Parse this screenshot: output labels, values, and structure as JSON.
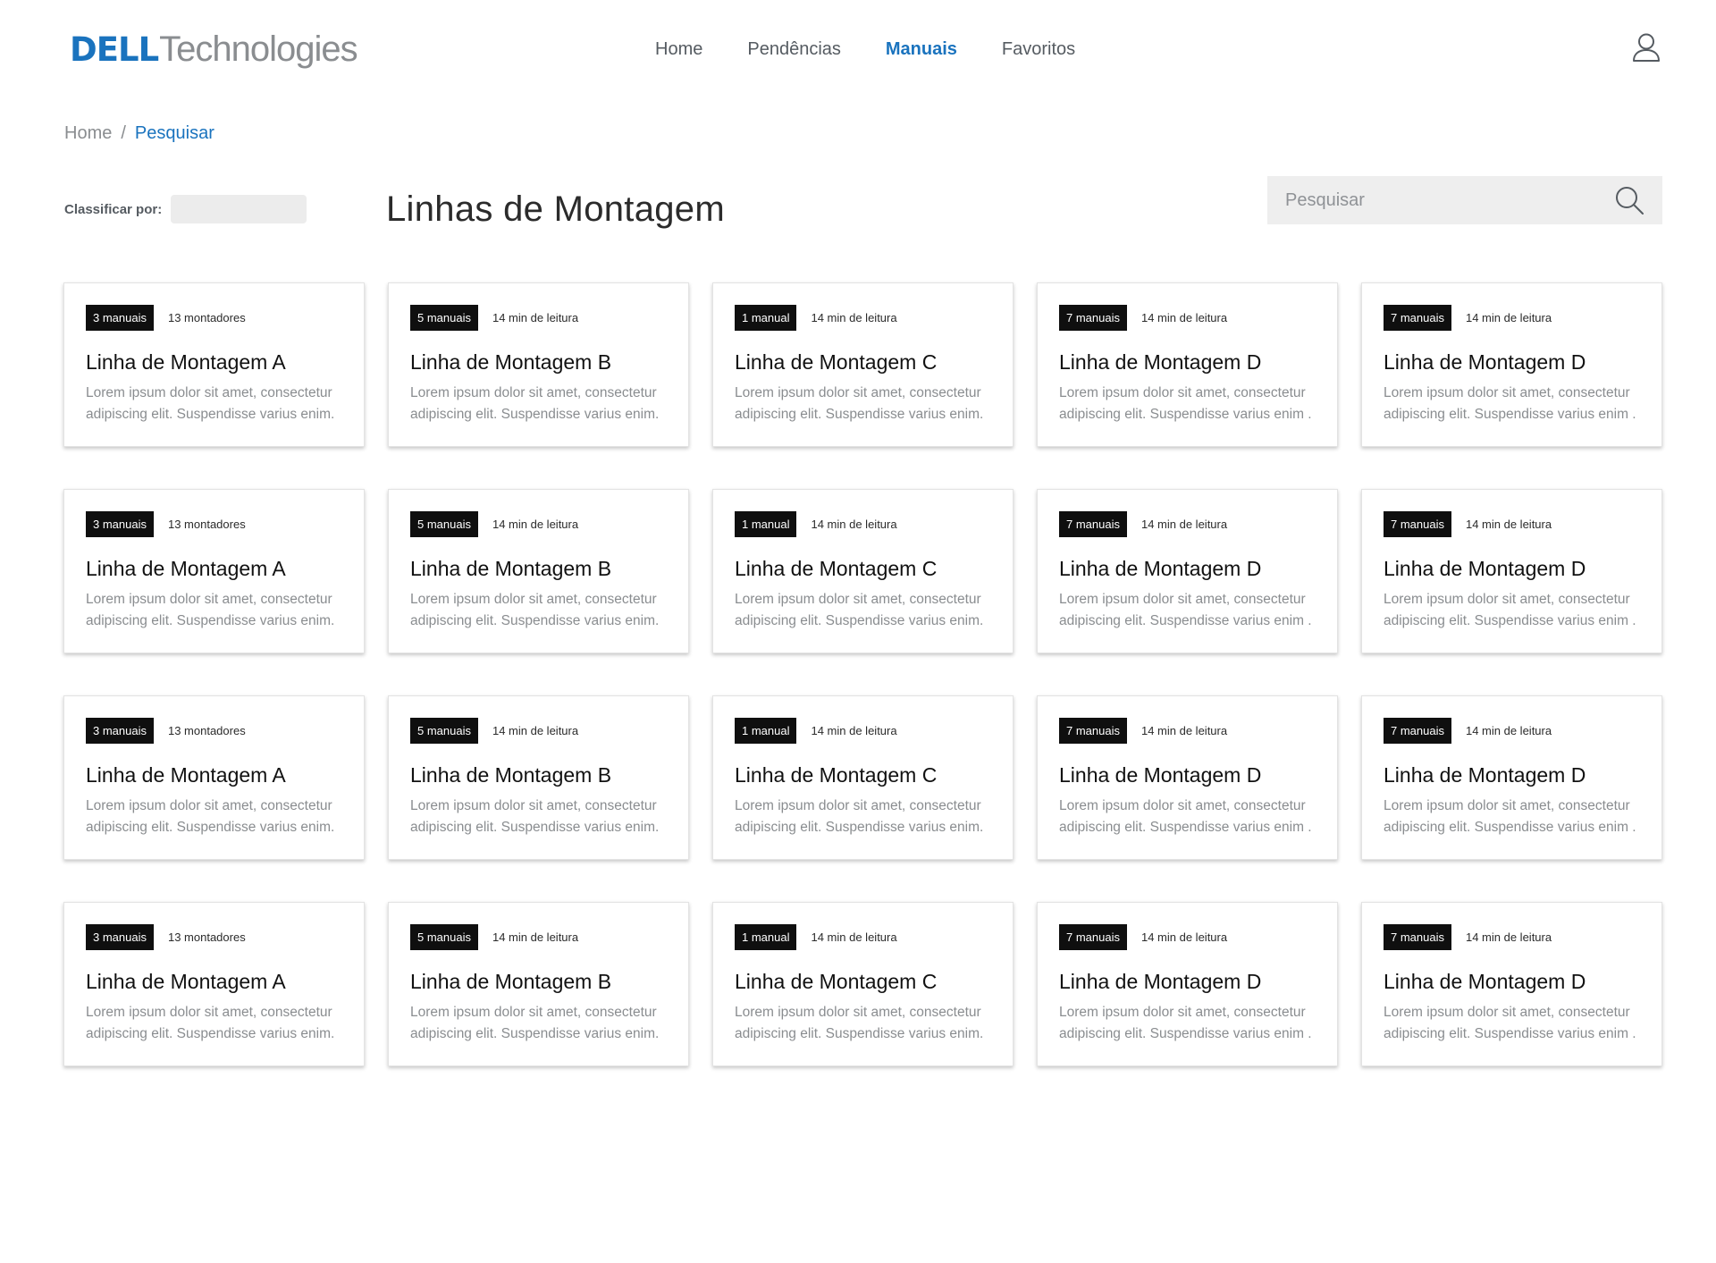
{
  "brand": {
    "logo_main": "DELL",
    "logo_sub": "Technologies"
  },
  "nav": {
    "items": [
      {
        "label": "Home",
        "active": false
      },
      {
        "label": "Pendências",
        "active": false
      },
      {
        "label": "Manuais",
        "active": true
      },
      {
        "label": "Favoritos",
        "active": false
      }
    ]
  },
  "user": {
    "icon": "user-icon"
  },
  "breadcrumb": {
    "home": "Home",
    "separator": "/",
    "current": "Pesquisar"
  },
  "sort": {
    "label": "Classificar por:",
    "value": ""
  },
  "page": {
    "title": "Linhas de Montagem"
  },
  "search": {
    "placeholder": "Pesquisar",
    "icon": "search-icon"
  },
  "colors": {
    "accent": "#1a73be",
    "badge_bg": "#0f0f0f",
    "muted_text": "#8a8d90",
    "search_bg": "#eeeeee"
  },
  "cards": [
    {
      "badge": "3 manuais",
      "meta": "13 montadores",
      "title": "Linha de Montagem A",
      "desc": "Lorem ipsum dolor sit amet, consectetur\nadipiscing elit. Suspendisse varius enim."
    },
    {
      "badge": "5 manuais",
      "meta": "14 min de leitura",
      "title": "Linha de Montagem B",
      "desc": "Lorem ipsum dolor sit amet, consectetur\nadipiscing elit. Suspendisse varius enim."
    },
    {
      "badge": "1 manual",
      "meta": "14 min de leitura",
      "title": "Linha de Montagem C",
      "desc": "Lorem ipsum dolor sit amet, consectetur\nadipiscing elit. Suspendisse varius enim."
    },
    {
      "badge": "7 manuais",
      "meta": "14 min de leitura",
      "title": "Linha de Montagem D",
      "desc": "Lorem ipsum dolor sit amet, consectetur\nadipiscing elit. Suspendisse varius enim ."
    },
    {
      "badge": "7 manuais",
      "meta": "14 min de leitura",
      "title": "Linha de Montagem D",
      "desc": "Lorem ipsum dolor sit amet, consectetur\nadipiscing elit. Suspendisse varius enim ."
    },
    {
      "badge": "3 manuais",
      "meta": "13 montadores",
      "title": "Linha de Montagem A",
      "desc": "Lorem ipsum dolor sit amet, consectetur\nadipiscing elit. Suspendisse varius enim."
    },
    {
      "badge": "5 manuais",
      "meta": "14 min de leitura",
      "title": "Linha de Montagem B",
      "desc": "Lorem ipsum dolor sit amet, consectetur\nadipiscing elit. Suspendisse varius enim."
    },
    {
      "badge": "1 manual",
      "meta": "14 min de leitura",
      "title": "Linha de Montagem C",
      "desc": "Lorem ipsum dolor sit amet, consectetur\nadipiscing elit. Suspendisse varius enim."
    },
    {
      "badge": "7 manuais",
      "meta": "14 min de leitura",
      "title": "Linha de Montagem D",
      "desc": "Lorem ipsum dolor sit amet, consectetur\nadipiscing elit. Suspendisse varius enim ."
    },
    {
      "badge": "7 manuais",
      "meta": "14 min de leitura",
      "title": "Linha de Montagem D",
      "desc": "Lorem ipsum dolor sit amet, consectetur\nadipiscing elit. Suspendisse varius enim ."
    },
    {
      "badge": "3 manuais",
      "meta": "13 montadores",
      "title": "Linha de Montagem A",
      "desc": "Lorem ipsum dolor sit amet, consectetur\nadipiscing elit. Suspendisse varius enim."
    },
    {
      "badge": "5 manuais",
      "meta": "14 min de leitura",
      "title": "Linha de Montagem B",
      "desc": "Lorem ipsum dolor sit amet, consectetur\nadipiscing elit. Suspendisse varius enim."
    },
    {
      "badge": "1 manual",
      "meta": "14 min de leitura",
      "title": "Linha de Montagem C",
      "desc": "Lorem ipsum dolor sit amet, consectetur\nadipiscing elit. Suspendisse varius enim."
    },
    {
      "badge": "7 manuais",
      "meta": "14 min de leitura",
      "title": "Linha de Montagem D",
      "desc": "Lorem ipsum dolor sit amet, consectetur\nadipiscing elit. Suspendisse varius enim ."
    },
    {
      "badge": "7 manuais",
      "meta": "14 min de leitura",
      "title": "Linha de Montagem D",
      "desc": "Lorem ipsum dolor sit amet, consectetur\nadipiscing elit. Suspendisse varius enim ."
    },
    {
      "badge": "3 manuais",
      "meta": "13 montadores",
      "title": "Linha de Montagem A",
      "desc": "Lorem ipsum dolor sit amet, consectetur\nadipiscing elit. Suspendisse varius enim."
    },
    {
      "badge": "5 manuais",
      "meta": "14 min de leitura",
      "title": "Linha de Montagem B",
      "desc": "Lorem ipsum dolor sit amet, consectetur\nadipiscing elit. Suspendisse varius enim."
    },
    {
      "badge": "1 manual",
      "meta": "14 min de leitura",
      "title": "Linha de Montagem C",
      "desc": "Lorem ipsum dolor sit amet, consectetur\nadipiscing elit. Suspendisse varius enim."
    },
    {
      "badge": "7 manuais",
      "meta": "14 min de leitura",
      "title": "Linha de Montagem D",
      "desc": "Lorem ipsum dolor sit amet, consectetur\nadipiscing elit. Suspendisse varius enim ."
    },
    {
      "badge": "7 manuais",
      "meta": "14 min de leitura",
      "title": "Linha de Montagem D",
      "desc": "Lorem ipsum dolor sit amet, consectetur\nadipiscing elit. Suspendisse varius enim ."
    }
  ]
}
